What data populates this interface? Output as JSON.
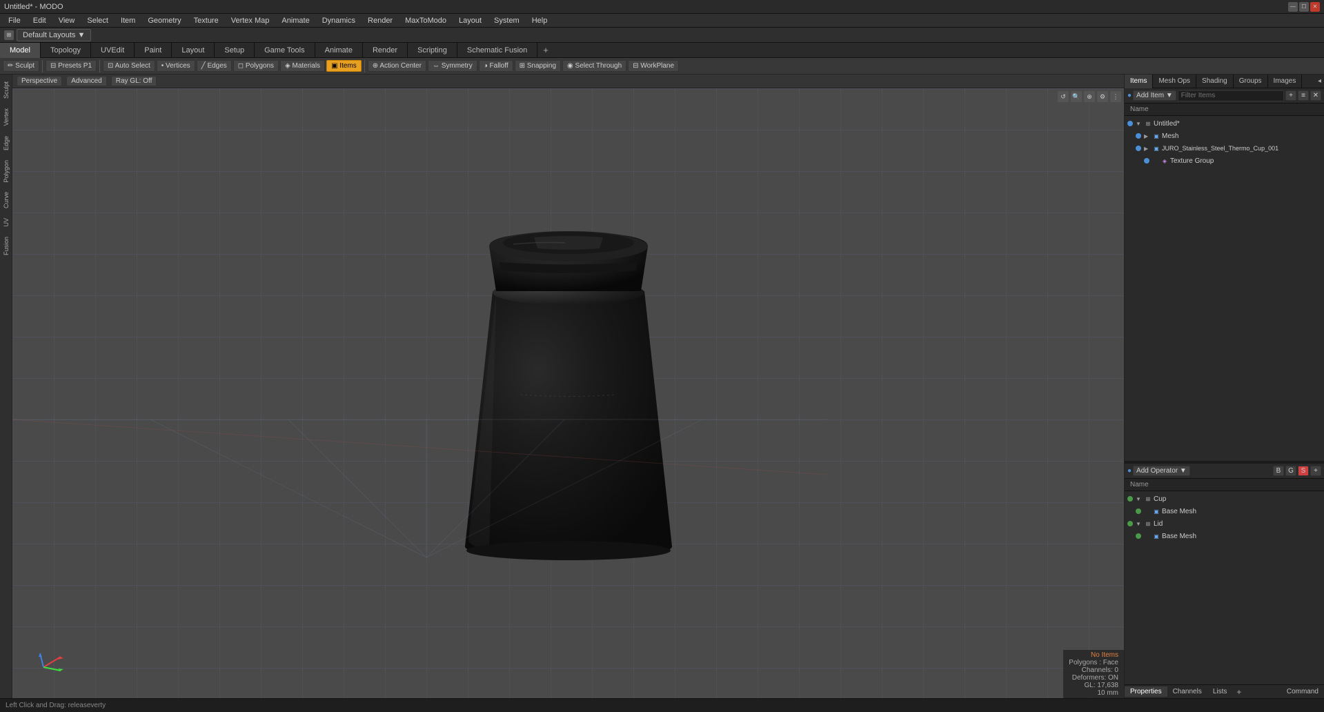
{
  "titlebar": {
    "title": "Untitled* - MODO",
    "win_controls": [
      "—",
      "☐",
      "✕"
    ]
  },
  "menubar": {
    "items": [
      "File",
      "Edit",
      "View",
      "Select",
      "Item",
      "Geometry",
      "Texture",
      "Vertex Map",
      "Animate",
      "Dynamics",
      "Render",
      "MaxToModo",
      "Layout",
      "System",
      "Help"
    ]
  },
  "layoutbar": {
    "icon_label": "⊞",
    "layout_name": "Default Layouts",
    "dropdown_arrow": "▼"
  },
  "modetabs": {
    "tabs": [
      "Model",
      "Topology",
      "UVEdit",
      "Paint",
      "Layout",
      "Setup",
      "Game Tools",
      "Animate",
      "Render",
      "Scripting",
      "Schematic Fusion"
    ],
    "active": "Model",
    "plus": "+"
  },
  "toolbar": {
    "sculpt": "Sculpt",
    "presets": "Presets",
    "presets_key": "P1",
    "auto_select": "Auto Select",
    "vertices": "Vertices",
    "edges": "Edges",
    "polygons": "Polygons",
    "materials": "Materials",
    "items": "Items",
    "action_center": "Action Center",
    "symmetry": "Symmetry",
    "falloff": "Falloff",
    "snapping": "Snapping",
    "select_through": "Select Through",
    "workplane": "WorkPlane"
  },
  "left_sidebar": {
    "tabs": [
      "Sculpt",
      "Vertex",
      "Edge",
      "Polygon",
      "Curve",
      "UV",
      "Fusion"
    ]
  },
  "viewport": {
    "view_type": "Perspective",
    "shader": "Advanced",
    "ray_gl": "Ray GL: Off",
    "corner_btns": [
      "↺",
      "🔍",
      "⊕",
      "⚙",
      "⋮"
    ]
  },
  "viewport_status": {
    "no_items": "No Items",
    "polygons": "Polygons : Face",
    "channels": "Channels: 0",
    "deformers": "Deformers: ON",
    "gl": "GL: 17,638",
    "size": "10 mm"
  },
  "right_panel": {
    "tabs": [
      "Items",
      "Mesh Ops",
      "Shading",
      "Groups",
      "Images"
    ],
    "expand_icon": "◂",
    "add_item_label": "Add Item",
    "filter_placeholder": "Filter Items",
    "col_name": "Name",
    "items_toolbar_icons": [
      "+",
      "≡",
      "✕"
    ],
    "tree": [
      {
        "id": "untitled",
        "label": "Untitled*",
        "level": 0,
        "type": "scene",
        "expanded": true,
        "icon": "▼"
      },
      {
        "id": "mesh",
        "label": "Mesh",
        "level": 1,
        "type": "mesh",
        "expanded": false,
        "icon": "▶"
      },
      {
        "id": "juro",
        "label": "JURO_Stainless_Steel_Thermo_Cup_001",
        "level": 1,
        "type": "mesh",
        "expanded": false,
        "icon": "▶"
      },
      {
        "id": "texture_group",
        "label": "Texture Group",
        "level": 2,
        "type": "texture",
        "expanded": false,
        "icon": ""
      }
    ]
  },
  "lower_panel": {
    "add_operator_label": "Add Operator",
    "col_name": "Name",
    "tree": [
      {
        "id": "cup",
        "label": "Cup",
        "level": 0,
        "type": "group",
        "expanded": true,
        "icon": "▼"
      },
      {
        "id": "cup_base_mesh",
        "label": "Base Mesh",
        "level": 1,
        "type": "mesh",
        "icon": ""
      },
      {
        "id": "lid",
        "label": "Lid",
        "level": 0,
        "type": "group",
        "expanded": true,
        "icon": "▼"
      },
      {
        "id": "lid_base_mesh",
        "label": "Base Mesh",
        "level": 1,
        "type": "mesh",
        "icon": ""
      }
    ]
  },
  "bottom_right": {
    "tabs": [
      "Properties",
      "Channels",
      "Lists"
    ],
    "active": "Properties",
    "plus": "+",
    "command_label": "Command"
  },
  "statusbar": {
    "message": "Left Click and Drag:  releaseverty"
  },
  "colors": {
    "active_tab_bg": "#4a4a4a",
    "toolbar_active": "#e8a020",
    "accent_blue": "#4a90d9",
    "panel_bg": "#2f2f2f",
    "viewport_bg": "#4a4a4a"
  }
}
